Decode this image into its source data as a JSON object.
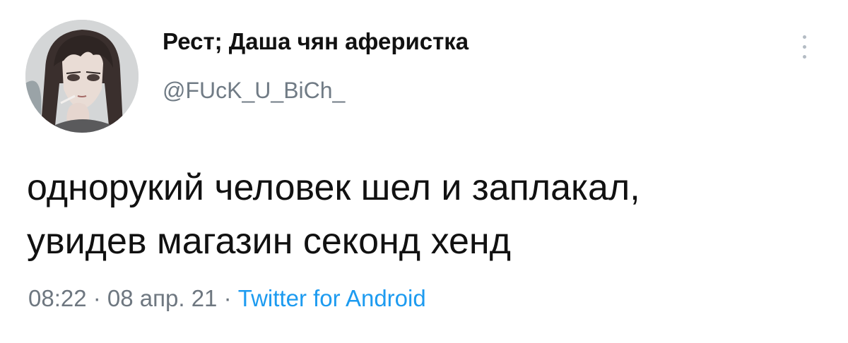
{
  "tweet": {
    "author": {
      "display_name": "Рест; Даша чян аферистка",
      "handle": "@FUcK_U_BiCh_",
      "avatar_icon": "avatar-anime-girl-illustration"
    },
    "text_lines": [
      "однорукий человек шел и заплакал,",
      "увидев магазин секонд хенд"
    ],
    "meta": {
      "time": "08:22",
      "separator": " · ",
      "date": "08 апр. 21",
      "source": "Twitter for Android"
    },
    "more_icon": "vertical-dots-icon"
  },
  "colors": {
    "text": "#111111",
    "secondary": "#6e7780",
    "link": "#1d9bf0",
    "background": "#ffffff"
  }
}
